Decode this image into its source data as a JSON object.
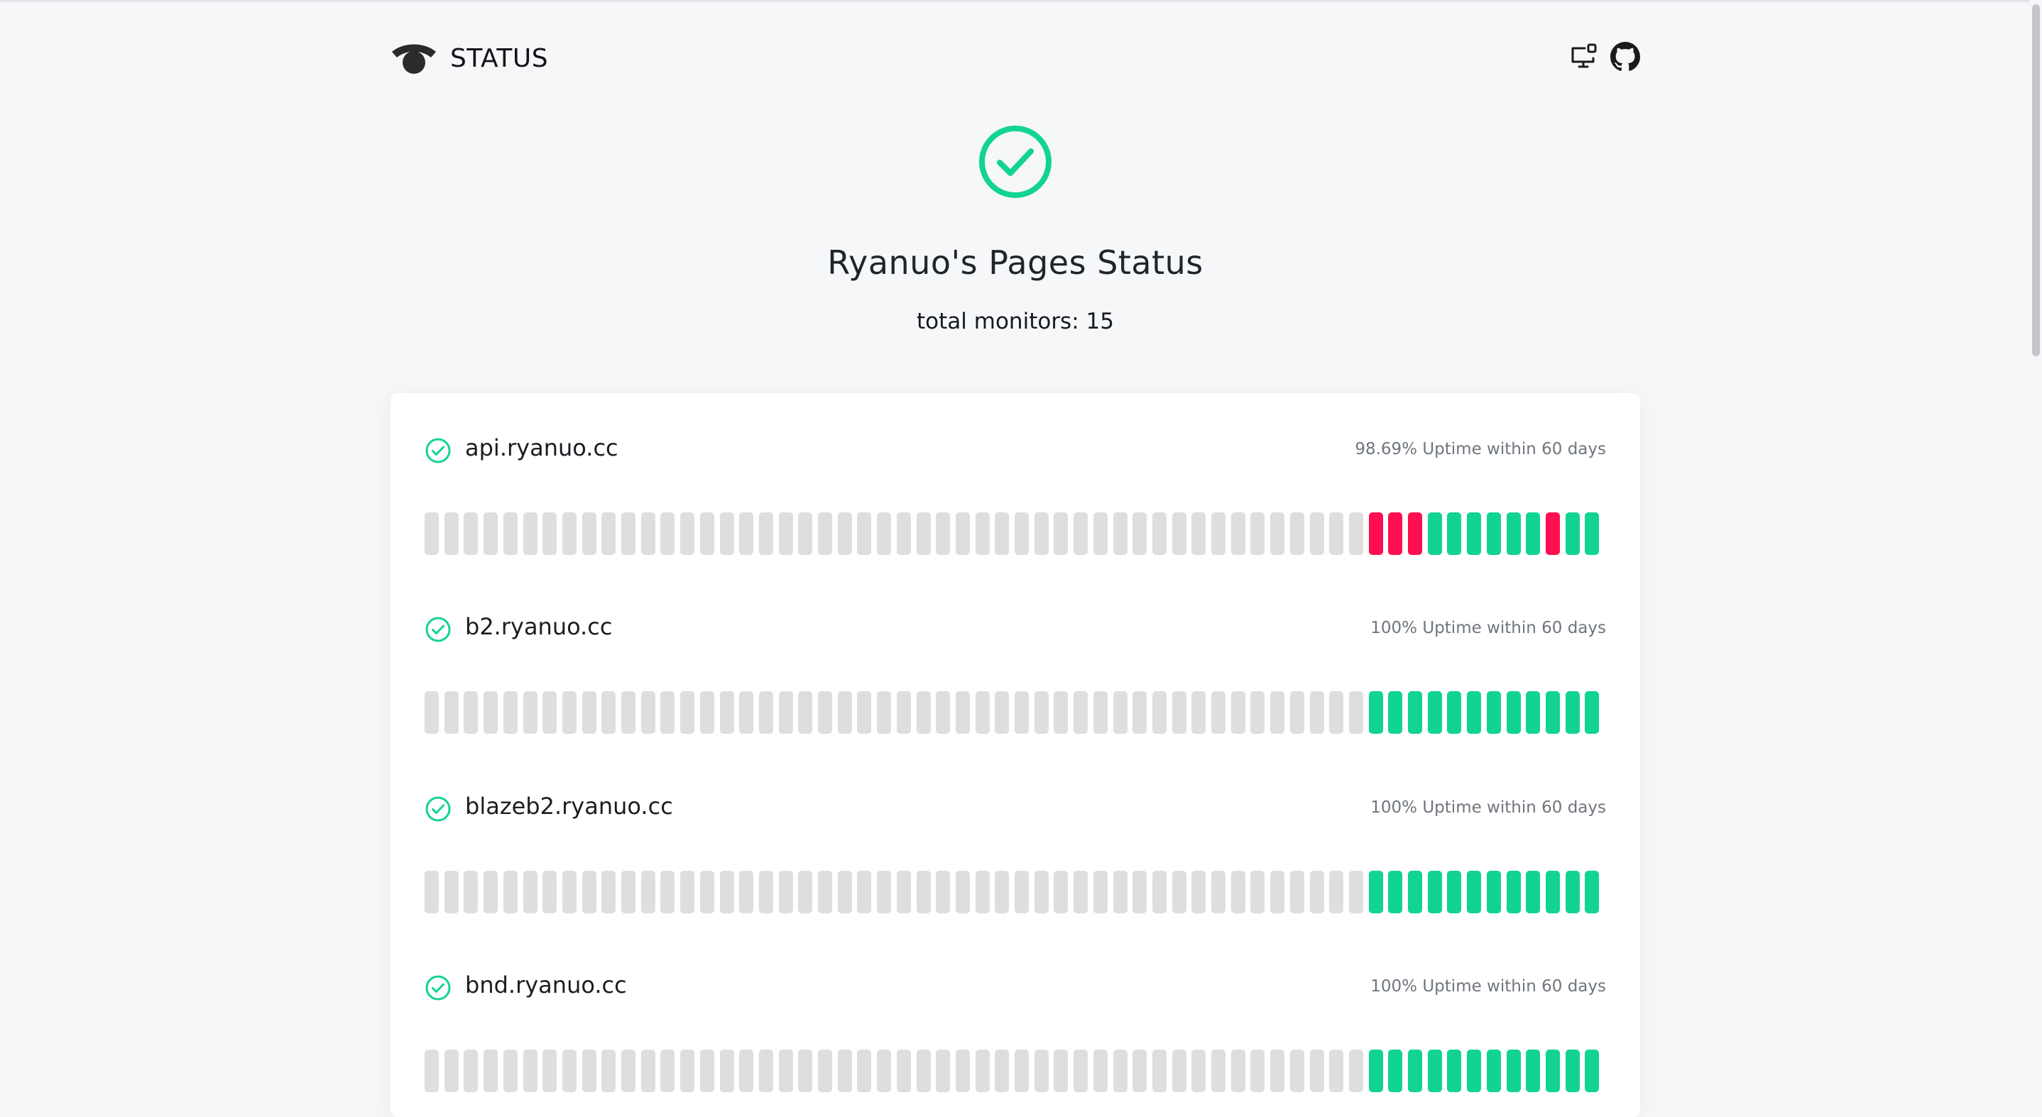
{
  "header": {
    "brand": "STATUS",
    "icons": [
      "monitor-icon",
      "github-icon"
    ]
  },
  "hero": {
    "title": "Ryanuo's Pages Status",
    "subtitle": "total monitors: 15"
  },
  "colors": {
    "up": "#12d492",
    "down": "#ff0f50",
    "nodata": "#dedede",
    "accent": "#12d492"
  },
  "bar_count": 60,
  "monitors": [
    {
      "name": "api.ryanuo.cc",
      "uptime": "98.69% Uptime within 60 days",
      "recent": [
        "down",
        "down",
        "down",
        "up",
        "up",
        "up",
        "up",
        "up",
        "up",
        "down",
        "up",
        "up"
      ]
    },
    {
      "name": "b2.ryanuo.cc",
      "uptime": "100% Uptime within 60 days",
      "recent": [
        "up",
        "up",
        "up",
        "up",
        "up",
        "up",
        "up",
        "up",
        "up",
        "up",
        "up",
        "up"
      ]
    },
    {
      "name": "blazeb2.ryanuo.cc",
      "uptime": "100% Uptime within 60 days",
      "recent": [
        "up",
        "up",
        "up",
        "up",
        "up",
        "up",
        "up",
        "up",
        "up",
        "up",
        "up",
        "up"
      ]
    },
    {
      "name": "bnd.ryanuo.cc",
      "uptime": "100% Uptime within 60 days",
      "recent": [
        "up",
        "up",
        "up",
        "up",
        "up",
        "up",
        "up",
        "up",
        "up",
        "up",
        "up",
        "up"
      ]
    }
  ]
}
